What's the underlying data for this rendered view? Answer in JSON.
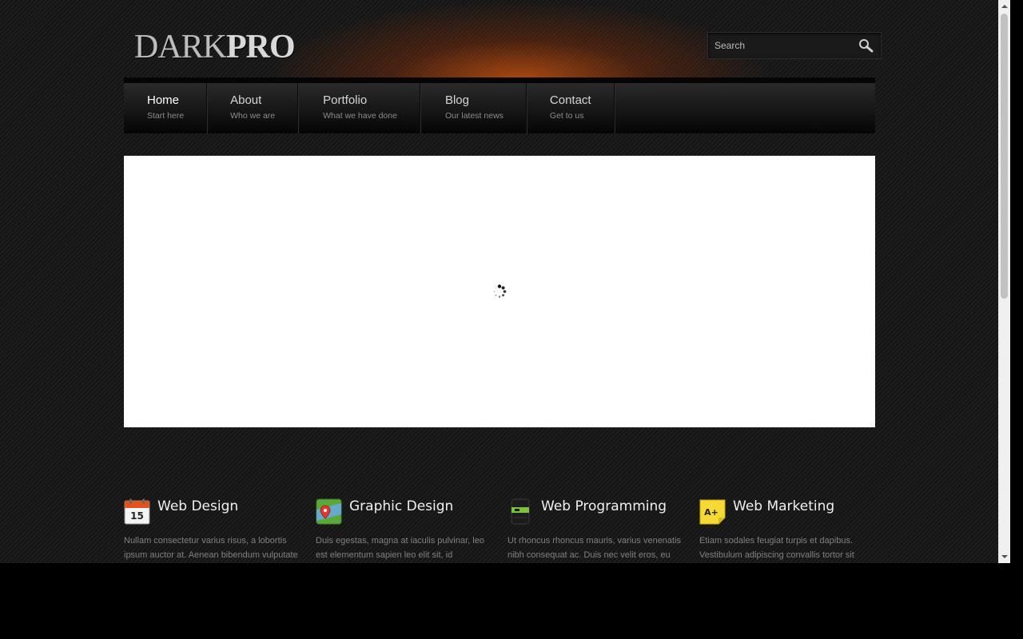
{
  "header": {
    "logo": {
      "light": "DARK",
      "bold": "PRO"
    },
    "search": {
      "placeholder": "Search",
      "icon": "magnifier-icon"
    }
  },
  "nav": {
    "items": [
      {
        "label": "Home",
        "sub": "Start here",
        "active": true
      },
      {
        "label": "About",
        "sub": "Who we are"
      },
      {
        "label": "Portfolio",
        "sub": "What we have done"
      },
      {
        "label": "Blog",
        "sub": "Our latest news"
      },
      {
        "label": "Contact",
        "sub": "Get to us"
      }
    ]
  },
  "slider": {
    "state": "loading",
    "icon": "loading-spinner-icon"
  },
  "features": [
    {
      "title": "Web Design",
      "icon": "calendar-icon",
      "icon_text": "15",
      "text": "Nullam consectetur varius risus, a lobortis ipsum auctor at. Aenean bibendum vulputate"
    },
    {
      "title": "Graphic Design",
      "icon": "map-pin-icon",
      "text": "Duis egestas, magna at iaculis pulvinar, leo est elementum sapien leo elit sit, id"
    },
    {
      "title": "Web Programming",
      "icon": "notebook-icon",
      "text": "Ut rhoncus rhoncus mauris, varius venenatis nibh consequat ac. Duis nec velit eros, eu"
    },
    {
      "title": "Web Marketing",
      "icon": "sticky-note-icon",
      "icon_text": "A+",
      "text": "Etiam sodales feugiat turpis et dapibus. Vestibulum adipiscing convallis tortor sit"
    }
  ],
  "colors": {
    "glow": "#c4500e",
    "background": "#1b1b1b",
    "heading": "#f0f0f0",
    "body_text": "#808080"
  }
}
